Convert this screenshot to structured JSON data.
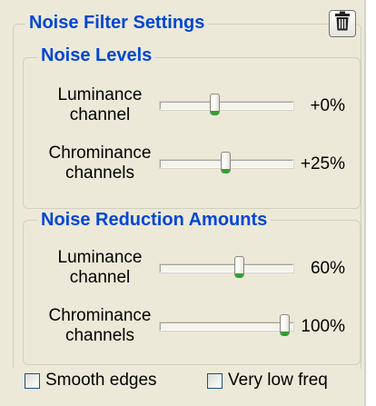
{
  "header": {
    "title": "Noise Filter Settings",
    "trash_icon": "trash-icon"
  },
  "levels": {
    "title": "Noise Levels",
    "rows": [
      {
        "label_line1": "Luminance",
        "label_line2": "channel",
        "value": "+0%",
        "slider_fraction": 0.41
      },
      {
        "label_line1": "Chrominance",
        "label_line2": "channels",
        "value": "+25%",
        "slider_fraction": 0.49
      }
    ]
  },
  "reduction": {
    "title": "Noise Reduction Amounts",
    "rows": [
      {
        "label_line1": "Luminance",
        "label_line2": "channel",
        "value": "60%",
        "slider_fraction": 0.59
      },
      {
        "label_line1": "Chrominance",
        "label_line2": "channels",
        "value": "100%",
        "slider_fraction": 0.94
      }
    ]
  },
  "options": {
    "smooth_edges": {
      "label": "Smooth edges",
      "checked": false
    },
    "very_low_freq": {
      "label": "Very low freq",
      "checked": false
    }
  },
  "colors": {
    "panel_bg": "#ece9d8",
    "legend_text": "#0046d5",
    "slider_thumb_accent": "#2fa12f"
  }
}
